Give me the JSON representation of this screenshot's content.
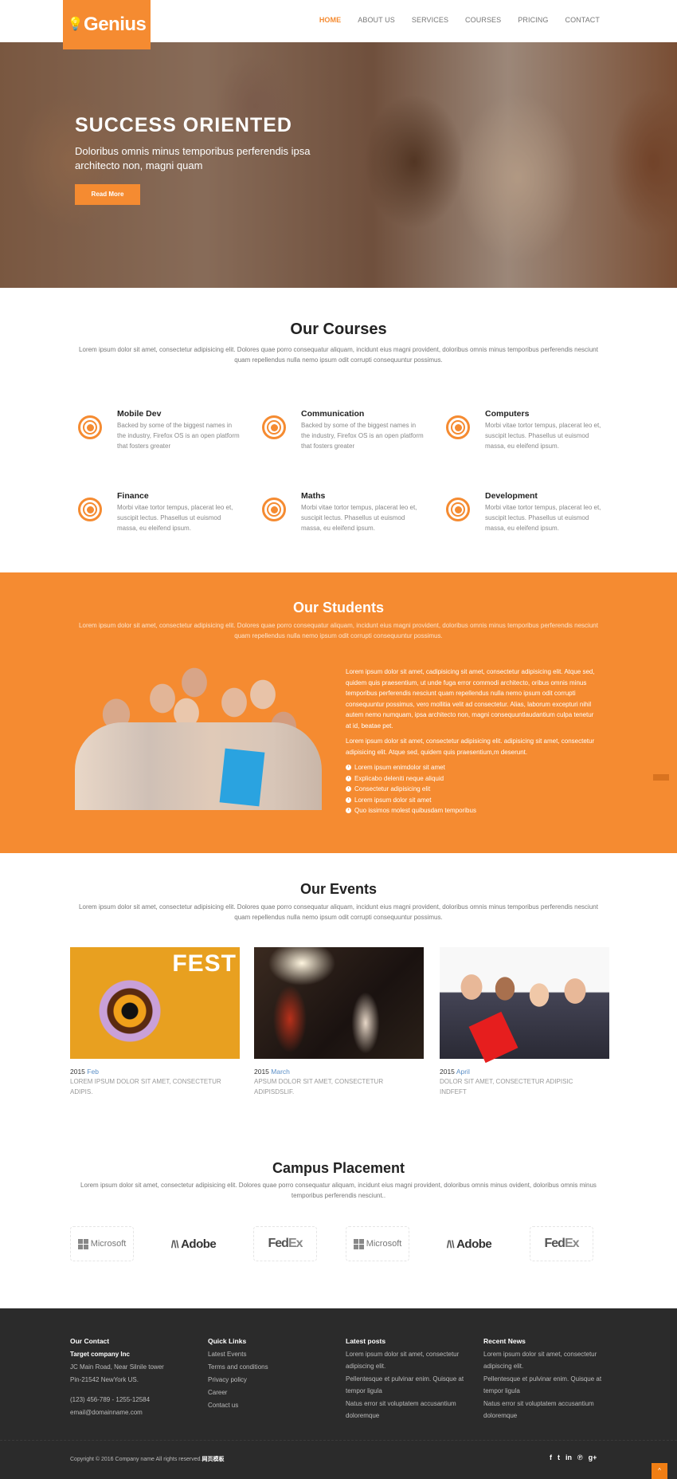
{
  "header": {
    "logo_text": "Genius",
    "nav": [
      {
        "label": "HOME",
        "active": true
      },
      {
        "label": "ABOUT US"
      },
      {
        "label": "SERVICES"
      },
      {
        "label": "COURSES"
      },
      {
        "label": "PRICING"
      },
      {
        "label": "CONTACT"
      }
    ]
  },
  "hero": {
    "title": "SUCCESS ORIENTED",
    "subtitle": "Doloribus omnis minus temporibus perferendis ipsa architecto non, magni quam",
    "button": "Read More"
  },
  "courses": {
    "title": "Our Courses",
    "desc": "Lorem ipsum dolor sit amet, consectetur adipisicing elit. Dolores quae porro consequatur aliquam, incidunt eius magni provident, doloribus omnis minus temporibus perferendis nesciunt quam repellendus nulla nemo ipsum odit corrupti consequuntur possimus.",
    "items": [
      {
        "title": "Mobile Dev",
        "text": "Backed by some of the biggest names in the industry, Firefox OS is an open platform that fosters greater"
      },
      {
        "title": "Communication",
        "text": "Backed by some of the biggest names in the industry, Firefox OS is an open platform that fosters greater"
      },
      {
        "title": "Computers",
        "text": "Morbi vitae tortor tempus, placerat leo et, suscipit lectus. Phasellus ut euismod massa, eu eleifend ipsum."
      },
      {
        "title": "Finance",
        "text": "Morbi vitae tortor tempus, placerat leo et, suscipit lectus. Phasellus ut euismod massa, eu eleifend ipsum."
      },
      {
        "title": "Maths",
        "text": "Morbi vitae tortor tempus, placerat leo et, suscipit lectus. Phasellus ut euismod massa, eu eleifend ipsum."
      },
      {
        "title": "Development",
        "text": "Morbi vitae tortor tempus, placerat leo et, suscipit lectus. Phasellus ut euismod massa, eu eleifend ipsum."
      }
    ]
  },
  "students": {
    "title": "Our Students",
    "desc": "Lorem ipsum dolor sit amet, consectetur adipisicing elit. Dolores quae porro consequatur aliquam, incidunt eius magni provident, doloribus omnis minus temporibus perferendis nesciunt quam repellendus nulla nemo ipsum odit corrupti consequuntur possimus.",
    "para1": "Lorem ipsum dolor sit amet, cadipisicing sit amet, consectetur adipisicing elit. Atque sed, quidem quis praesentium, ut unde fuga error commodi architecto, oribus omnis minus temporibus perferendis nesciunt quam repellendus nulla nemo ipsum odit corrupti consequuntur possimus, vero mollitia velit ad consectetur. Alias, laborum excepturi nihil autem nemo numquam, ipsa architecto non, magni consequuntlaudantium culpa tenetur at id, beatae pet.",
    "para2": "Lorem ipsum dolor sit amet, consectetur adipisicing elit. adipisicing sit amet, consectetur adipisicing elit. Atque sed, quidem quis praesentium,m deserunt.",
    "list": [
      "Lorem ipsum enimdolor sit amet",
      "Explicabo deleniti neque aliquid",
      "Consectetur adipisicing elit",
      "Lorem ipsum dolor sit amet",
      "Quo issimos molest quibusdam temporibus"
    ]
  },
  "events": {
    "title": "Our Events",
    "desc": "Lorem ipsum dolor sit amet, consectetur adipisicing elit. Dolores quae porro consequatur aliquam, incidunt eius magni provident, doloribus omnis minus temporibus perferendis nesciunt quam repellendus nulla nemo ipsum odit corrupti consequuntur possimus.",
    "items": [
      {
        "year": "2015",
        "month": "Feb",
        "text": "LOREM IPSUM DOLOR SIT AMET, CONSECTETUR ADIPIS.",
        "image_label": "FEST"
      },
      {
        "year": "2015",
        "month": "March",
        "text": "APSUM DOLOR SIT AMET, CONSECTETUR ADIPISDSLIF."
      },
      {
        "year": "2015",
        "month": "April",
        "text": "DOLOR SIT AMET, CONSECTETUR ADIPISIC INDFEFT"
      }
    ]
  },
  "placement": {
    "title": "Campus Placement",
    "desc": "Lorem ipsum dolor sit amet, consectetur adipisicing elit. Dolores quae porro consequatur aliquam, incidunt eius magni provident, doloribus omnis minus ovident, doloribus omnis minus temporibus perferendis nesciunt..",
    "logos": [
      "Microsoft",
      "Adobe",
      "FedEx",
      "Microsoft",
      "Adobe",
      "FedEx"
    ]
  },
  "footer": {
    "contact": {
      "heading": "Our Contact",
      "company": "Target company Inc",
      "address1": "JC Main Road, Near Silnile tower",
      "address2": "Pin-21542 NewYork US.",
      "phone": "(123) 456-789 - 1255-12584",
      "email": "email@domainname.com"
    },
    "quick_links": {
      "heading": "Quick Links",
      "links": [
        "Latest Events",
        "Terms and conditions",
        "Privacy policy",
        "Career",
        "Contact us"
      ]
    },
    "latest_posts": {
      "heading": "Latest posts",
      "items": [
        "Lorem ipsum dolor sit amet, consectetur adipiscing elit.",
        "Pellentesque et pulvinar enim. Quisque at tempor ligula",
        "Natus error sit voluptatem accusantium doloremque"
      ]
    },
    "recent_news": {
      "heading": "Recent News",
      "items": [
        "Lorem ipsum dolor sit amet, consectetur adipiscing elit.",
        "Pellentesque et pulvinar enim. Quisque at tempor ligula",
        "Natus error sit voluptatem accusantium doloremque"
      ]
    },
    "copyright": "Copyright © 2016 Company name All rights reserved.",
    "copyright_link": "网页模板",
    "social": [
      {
        "name": "facebook",
        "glyph": "f"
      },
      {
        "name": "twitter",
        "glyph": "t"
      },
      {
        "name": "linkedin",
        "glyph": "in"
      },
      {
        "name": "pinterest",
        "glyph": "℗"
      },
      {
        "name": "google-plus",
        "glyph": "g+"
      }
    ],
    "to_top": "^"
  }
}
